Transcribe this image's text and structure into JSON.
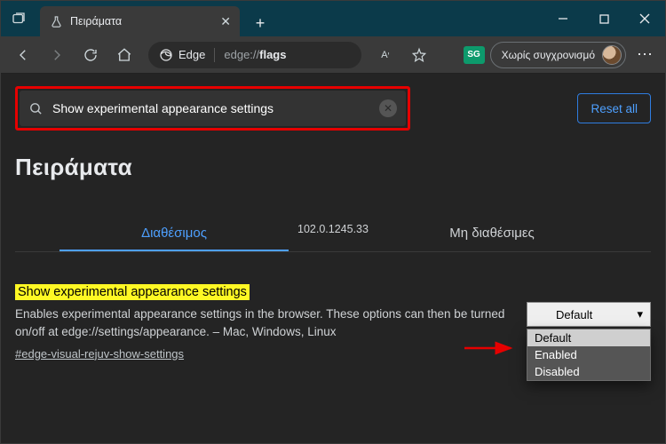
{
  "titlebar": {
    "tab_title": "Πειράματα"
  },
  "toolbar": {
    "edge_label": "Edge",
    "url_prefix": "edge://",
    "url_bold": "flags",
    "reader_label": "A⁹⁹",
    "badge": "SG",
    "sync_label": "Χωρίς συγχρονισμό"
  },
  "page": {
    "search_value": "Show experimental appearance settings",
    "reset_label": "Reset all",
    "heading": "Πειράματα",
    "version": "102.0.1245.33",
    "tabs": {
      "available": "Διαθέσιμος",
      "unavailable": "Μη διαθέσιμες"
    },
    "flag": {
      "name": "Show experimental appearance settings",
      "description": "Enables experimental appearance settings in the browser. These options can then be turned on/off at edge://settings/appearance. – Mac, Windows, Linux",
      "hash": "#edge-visual-rejuv-show-settings"
    },
    "dropdown": {
      "selected": "Default",
      "options": [
        "Default",
        "Enabled",
        "Disabled"
      ]
    }
  }
}
